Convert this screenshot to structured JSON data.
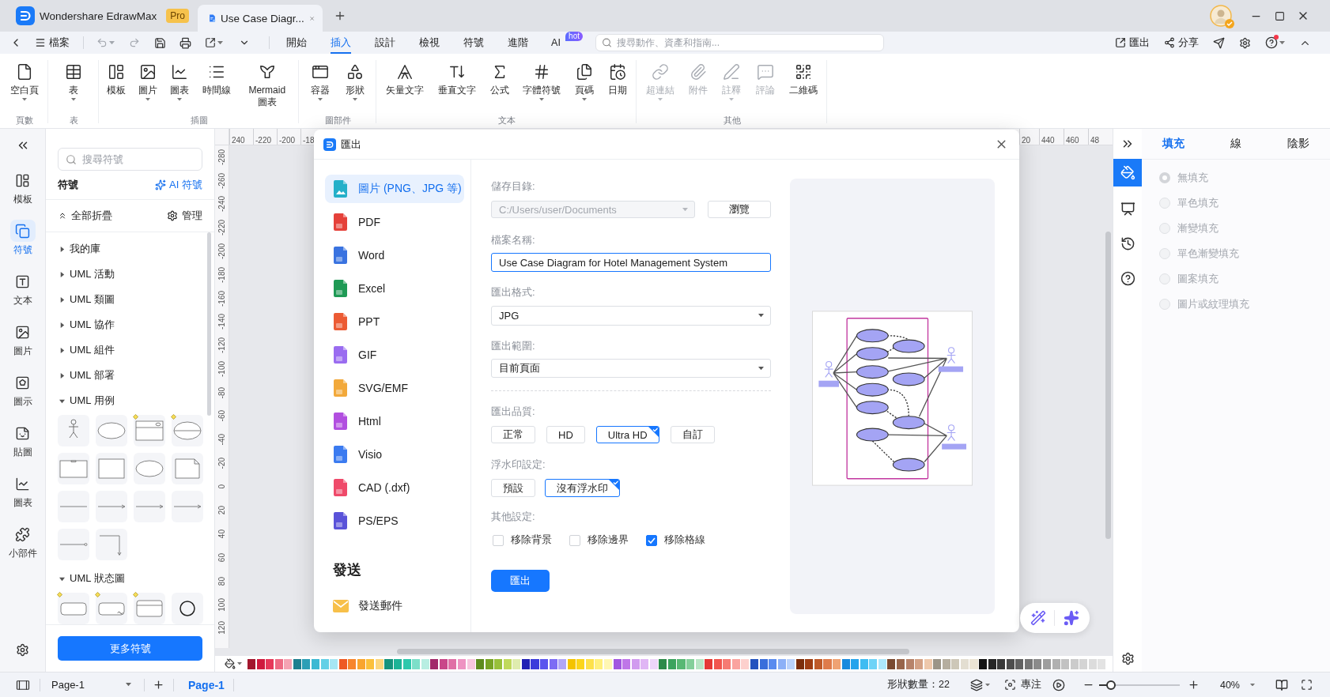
{
  "title_bar": {
    "app": {
      "name": "Wondershare EdrawMax",
      "badge": "Pro"
    },
    "tabs": [
      {
        "label": "Use Case Diagr...",
        "selected": true
      }
    ]
  },
  "menu_bar": {
    "file_menu": "檔案",
    "tabs": [
      {
        "label": "開始",
        "selected": false
      },
      {
        "label": "插入",
        "selected": true
      },
      {
        "label": "設計",
        "selected": false
      },
      {
        "label": "檢視",
        "selected": false
      },
      {
        "label": "符號",
        "selected": false
      },
      {
        "label": "進階",
        "selected": false
      },
      {
        "label": "AI",
        "selected": false,
        "badge": "hot"
      }
    ],
    "search": {
      "placeholder": "搜尋動作、資產和指南..."
    },
    "actions": [
      {
        "label": "匯出"
      },
      {
        "label": "分享"
      }
    ],
    "help": {
      "notification": true
    }
  },
  "ribbon": {
    "groups": [
      {
        "label": "頁數",
        "items": [
          {
            "label": "空白頁",
            "caret": true,
            "disabled": false
          }
        ]
      },
      {
        "label": "表",
        "items": [
          {
            "label": "表",
            "caret": true,
            "disabled": false
          }
        ]
      },
      {
        "label": "插圖",
        "items": [
          {
            "label": "模板",
            "caret": false,
            "disabled": false
          },
          {
            "label": "圖片",
            "caret": true,
            "disabled": false
          },
          {
            "label": "圖表",
            "caret": true,
            "disabled": false
          },
          {
            "label": "時間線",
            "caret": false,
            "disabled": false
          },
          {
            "label": "Mermaid 圖表",
            "caret": false,
            "disabled": false
          }
        ]
      },
      {
        "label": "圖部件",
        "items": [
          {
            "label": "容器",
            "caret": true,
            "disabled": false
          },
          {
            "label": "形狀",
            "caret": true,
            "disabled": false
          }
        ]
      },
      {
        "label": "文本",
        "items": [
          {
            "label": "矢量文字",
            "caret": false,
            "disabled": false
          },
          {
            "label": "垂直文字",
            "caret": false,
            "disabled": false
          },
          {
            "label": "公式",
            "caret": false,
            "disabled": false
          },
          {
            "label": "字體符號",
            "caret": true,
            "disabled": false
          },
          {
            "label": "頁碼",
            "caret": true,
            "disabled": false
          },
          {
            "label": "日期",
            "caret": false,
            "disabled": false
          }
        ]
      },
      {
        "label": "其他",
        "items": [
          {
            "label": "超連結",
            "caret": true,
            "disabled": true
          },
          {
            "label": "附件",
            "caret": false,
            "disabled": true
          },
          {
            "label": "註釋",
            "caret": true,
            "disabled": true
          },
          {
            "label": "評論",
            "caret": false,
            "disabled": true
          },
          {
            "label": "二維碼",
            "caret": false,
            "disabled": false
          }
        ]
      }
    ]
  },
  "left_rail": {
    "items": [
      {
        "label": "模板",
        "selected": false
      },
      {
        "label": "符號",
        "selected": true
      },
      {
        "label": "文本",
        "selected": false
      },
      {
        "label": "圖片",
        "selected": false
      },
      {
        "label": "圖示",
        "selected": false
      },
      {
        "label": "貼圖",
        "selected": false
      },
      {
        "label": "圖表",
        "selected": false
      },
      {
        "label": "小部件",
        "selected": false
      }
    ]
  },
  "symbol_panel": {
    "search": {
      "placeholder": "搜尋符號"
    },
    "title": "符號",
    "ai_button": "AI 符號",
    "collapse_all": "全部折疊",
    "manage": "管理",
    "categories": [
      {
        "label": "我的庫",
        "expanded": false
      },
      {
        "label": "UML 活動",
        "expanded": false
      },
      {
        "label": "UML 類圖",
        "expanded": false
      },
      {
        "label": "UML 協作",
        "expanded": false
      },
      {
        "label": "UML 組件",
        "expanded": false
      },
      {
        "label": "UML 部署",
        "expanded": false
      },
      {
        "label": "UML 用例",
        "expanded": true,
        "shapes": [
          {
            "kind": "actor",
            "marked": false
          },
          {
            "kind": "ellipse",
            "marked": false
          },
          {
            "kind": "usecase_box",
            "marked": true
          },
          {
            "kind": "split_ellipse",
            "marked": true
          },
          {
            "kind": "boundary",
            "marked": false
          },
          {
            "kind": "rect",
            "marked": false
          },
          {
            "kind": "ellipse",
            "marked": false
          },
          {
            "kind": "note",
            "marked": false
          },
          {
            "kind": "line",
            "marked": false
          },
          {
            "kind": "arrow",
            "marked": false
          },
          {
            "kind": "arrow",
            "marked": false
          },
          {
            "kind": "arrow",
            "marked": false
          },
          {
            "kind": "line_circle",
            "marked": false
          },
          {
            "kind": "elbow",
            "marked": false
          }
        ]
      },
      {
        "label": "UML 狀态圖",
        "expanded": true,
        "shapes": [
          {
            "kind": "state",
            "marked": true
          },
          {
            "kind": "state_composite",
            "marked": true
          },
          {
            "kind": "compartment",
            "marked": true
          },
          {
            "kind": "circle",
            "marked": false
          }
        ]
      }
    ],
    "more_button": "更多符號"
  },
  "canvas": {
    "top_ruler": {
      "left_labels": [
        "240",
        "-220",
        "-200",
        "-18"
      ],
      "right_labels": [
        "20",
        "440",
        "460",
        "48"
      ]
    },
    "left_ruler": {
      "labels": [
        "-280",
        "-260",
        "-240",
        "-220",
        "-200",
        "-180",
        "-160",
        "-140",
        "-120",
        "-100",
        "-80",
        "-60",
        "-40",
        "-20",
        "0",
        "20",
        "40",
        "60",
        "80",
        "100",
        "120"
      ]
    },
    "palette": {
      "swatches": [
        {
          "color": "#a3172e"
        },
        {
          "color": "#cf1a3e"
        },
        {
          "color": "#e6395a"
        },
        {
          "color": "#ee6b84"
        },
        {
          "color": "#f5a3b3"
        },
        {
          "color": "#1f7f8f"
        },
        {
          "color": "#2c9fb6"
        },
        {
          "color": "#3db9d3"
        },
        {
          "color": "#63d0e6"
        },
        {
          "color": "#a6e6f3"
        },
        {
          "color": "#ee5a24"
        },
        {
          "color": "#f7852c"
        },
        {
          "color": "#f9a52f"
        },
        {
          "color": "#fbc03b"
        },
        {
          "color": "#fcd67c"
        },
        {
          "color": "#15937d"
        },
        {
          "color": "#1db397"
        },
        {
          "color": "#2dc8ac"
        },
        {
          "color": "#7cdfc9"
        },
        {
          "color": "#b8eee2"
        },
        {
          "color": "#a2286a"
        },
        {
          "color": "#c94689"
        },
        {
          "color": "#e06fa6"
        },
        {
          "color": "#ee93c2"
        },
        {
          "color": "#f7c6de"
        },
        {
          "color": "#5e8b1e"
        },
        {
          "color": "#77a325"
        },
        {
          "color": "#98c03a"
        },
        {
          "color": "#c0d95c"
        },
        {
          "color": "#dfecae"
        },
        {
          "color": "#2121b5"
        },
        {
          "color": "#3b3bdb"
        },
        {
          "color": "#5b55ee"
        },
        {
          "color": "#7d6cf4"
        },
        {
          "color": "#b1a6f7"
        },
        {
          "color": "#f4c300"
        },
        {
          "color": "#fbd51b"
        },
        {
          "color": "#fde14a"
        },
        {
          "color": "#fff07c"
        },
        {
          "color": "#fff7b3"
        },
        {
          "color": "#a257e0"
        },
        {
          "color": "#bf76e8"
        },
        {
          "color": "#d19bef"
        },
        {
          "color": "#e0b6f5"
        },
        {
          "color": "#eed6fa"
        },
        {
          "color": "#2c8a4a"
        },
        {
          "color": "#3ba35e"
        },
        {
          "color": "#58b874"
        },
        {
          "color": "#84cf9a"
        },
        {
          "color": "#b8e5c4"
        },
        {
          "color": "#e53935"
        },
        {
          "color": "#f1554e"
        },
        {
          "color": "#f67a73"
        },
        {
          "color": "#faa39f"
        },
        {
          "color": "#fdd0cd"
        },
        {
          "color": "#2352be"
        },
        {
          "color": "#3a6edb"
        },
        {
          "color": "#5a8bef"
        },
        {
          "color": "#8cb0f7"
        },
        {
          "color": "#bad2fb"
        },
        {
          "color": "#7b2d0b"
        },
        {
          "color": "#9e3c12"
        },
        {
          "color": "#bf5a29"
        },
        {
          "color": "#de7b4b"
        },
        {
          "color": "#efa273"
        },
        {
          "color": "#1a8ade"
        },
        {
          "color": "#25a4ec"
        },
        {
          "color": "#3dbcf2"
        },
        {
          "color": "#6dd3f7"
        },
        {
          "color": "#ade7fb"
        },
        {
          "color": "#7a4a31"
        },
        {
          "color": "#98654b"
        },
        {
          "color": "#b7836a"
        },
        {
          "color": "#d3a185"
        },
        {
          "color": "#eec8ab"
        },
        {
          "color": "#9b9588"
        },
        {
          "color": "#b5ae9f"
        },
        {
          "color": "#cdc7b8"
        },
        {
          "color": "#e3ded1"
        },
        {
          "color": "#ebe4d4"
        },
        {
          "color": "#141414"
        },
        {
          "color": "#262626"
        },
        {
          "color": "#393939"
        },
        {
          "color": "#4d4d4d"
        },
        {
          "color": "#616161"
        },
        {
          "color": "#757575"
        },
        {
          "color": "#8a8a8a"
        },
        {
          "color": "#9e9e9e"
        },
        {
          "color": "#b0b0b0"
        },
        {
          "color": "#c2c2c2"
        },
        {
          "color": "#cbcbcb"
        },
        {
          "color": "#d4d4d4"
        },
        {
          "color": "#dcdcdc"
        },
        {
          "color": "#e3e3e3"
        }
      ]
    }
  },
  "export_dialog": {
    "title": "匯出",
    "formats": [
      {
        "label": "圖片 (PNG、JPG 等)",
        "kind": "image",
        "color": "#25b0c9",
        "selected": true
      },
      {
        "label": "PDF",
        "kind": "file",
        "color": "#e5413a",
        "selected": false
      },
      {
        "label": "Word",
        "kind": "file",
        "color": "#3a73e0",
        "selected": false
      },
      {
        "label": "Excel",
        "kind": "file",
        "color": "#1f9a55",
        "selected": false
      },
      {
        "label": "PPT",
        "kind": "file",
        "color": "#ec5b34",
        "selected": false
      },
      {
        "label": "GIF",
        "kind": "file",
        "color": "#9a6cf0",
        "selected": false
      },
      {
        "label": "SVG/EMF",
        "kind": "file",
        "color": "#f2a93b",
        "selected": false
      },
      {
        "label": "Html",
        "kind": "file",
        "color": "#b24fe0",
        "selected": false
      },
      {
        "label": "Visio",
        "kind": "file",
        "color": "#3b7bf0",
        "selected": false
      },
      {
        "label": "CAD (.dxf)",
        "kind": "file",
        "color": "#ef4a6a",
        "selected": false
      },
      {
        "label": "PS/EPS",
        "kind": "file",
        "color": "#5a53d9",
        "selected": false
      }
    ],
    "send_heading": "發送",
    "send_items": [
      {
        "label": "發送郵件"
      }
    ],
    "form": {
      "save_directory": {
        "label": "儲存目錄:",
        "value": "C:/Users/user/Documents",
        "disabled": true
      },
      "browse_button": "瀏覽",
      "file_name": {
        "label": "檔案名稱:",
        "value": "Use Case Diagram for Hotel Management System",
        "focused": true
      },
      "format": {
        "label": "匯出格式:",
        "value": "JPG"
      },
      "range": {
        "label": "匯出範圍:",
        "value": "目前頁面"
      },
      "quality": {
        "label": "匯出品質:",
        "options": [
          {
            "label": "正常",
            "selected": false
          },
          {
            "label": "HD",
            "selected": false
          },
          {
            "label": "Ultra HD",
            "selected": true
          },
          {
            "label": "自訂",
            "selected": false
          }
        ]
      },
      "watermark": {
        "label": "浮水印設定:",
        "options": [
          {
            "label": "預設",
            "selected": false
          },
          {
            "label": "沒有浮水印",
            "selected": true
          }
        ]
      },
      "other_settings": {
        "label": "其他設定:",
        "checkboxes": [
          {
            "label": "移除背景",
            "checked": false
          },
          {
            "label": "移除邊界",
            "checked": false
          },
          {
            "label": "移除格線",
            "checked": true
          }
        ]
      },
      "submit_button": "匯出"
    }
  },
  "right_rail": {
    "items": [
      {
        "selected": true
      },
      {
        "selected": false
      },
      {
        "selected": false
      },
      {
        "selected": false
      }
    ]
  },
  "format_panel": {
    "tabs": [
      {
        "label": "填充",
        "selected": true
      },
      {
        "label": "線",
        "selected": false
      },
      {
        "label": "陰影",
        "selected": false
      }
    ],
    "fill_options": [
      {
        "label": "無填充",
        "selected": true,
        "disabled": true
      },
      {
        "label": "單色填充",
        "selected": false,
        "disabled": true
      },
      {
        "label": "漸變填充",
        "selected": false,
        "disabled": true
      },
      {
        "label": "單色漸變填充",
        "selected": false,
        "disabled": true
      },
      {
        "label": "圖案填充",
        "selected": false,
        "disabled": true
      },
      {
        "label": "圖片或紋理填充",
        "selected": false,
        "disabled": true
      }
    ]
  },
  "status_bar": {
    "page_select": "Page-1",
    "pages": [
      {
        "label": "Page-1",
        "selected": true
      }
    ],
    "shape_count": "形狀數量：22",
    "focus_mode": "專注",
    "zoom": {
      "level": 0.15,
      "reading": "40%"
    }
  }
}
